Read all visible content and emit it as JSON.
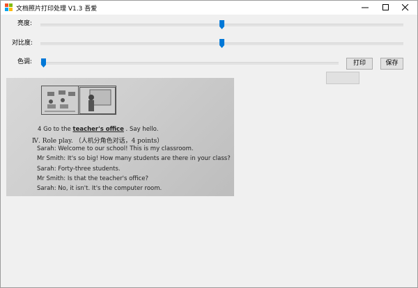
{
  "window": {
    "title": "文档照片打印处理 V1.3   吾爱",
    "accent_color": "#0078d7"
  },
  "controls": {
    "brightness_label": "亮度:",
    "contrast_label": "对比度:",
    "hue_label": "色调:",
    "brightness_value": 0.5,
    "contrast_value": 0.5,
    "hue_value": 0.0,
    "print_label": "打印",
    "save_label": "保存"
  },
  "document": {
    "line1_prefix": "4 Go to the ",
    "line1_underlined": "teacher's office",
    "line1_suffix": " . Say hello.",
    "line2": "Ⅳ. Role play. （人机分角色对话，4 points）",
    "line3": "Sarah: Welcome to our school! This is my classroom.",
    "line4": "Mr Smith: It's so big! How many students are there in your class?",
    "line5": "Sarah: Forty-three students.",
    "line6": "Mr Smith: Is that the teacher's office?",
    "line7": "Sarah: No, it isn't. It's the computer room."
  }
}
